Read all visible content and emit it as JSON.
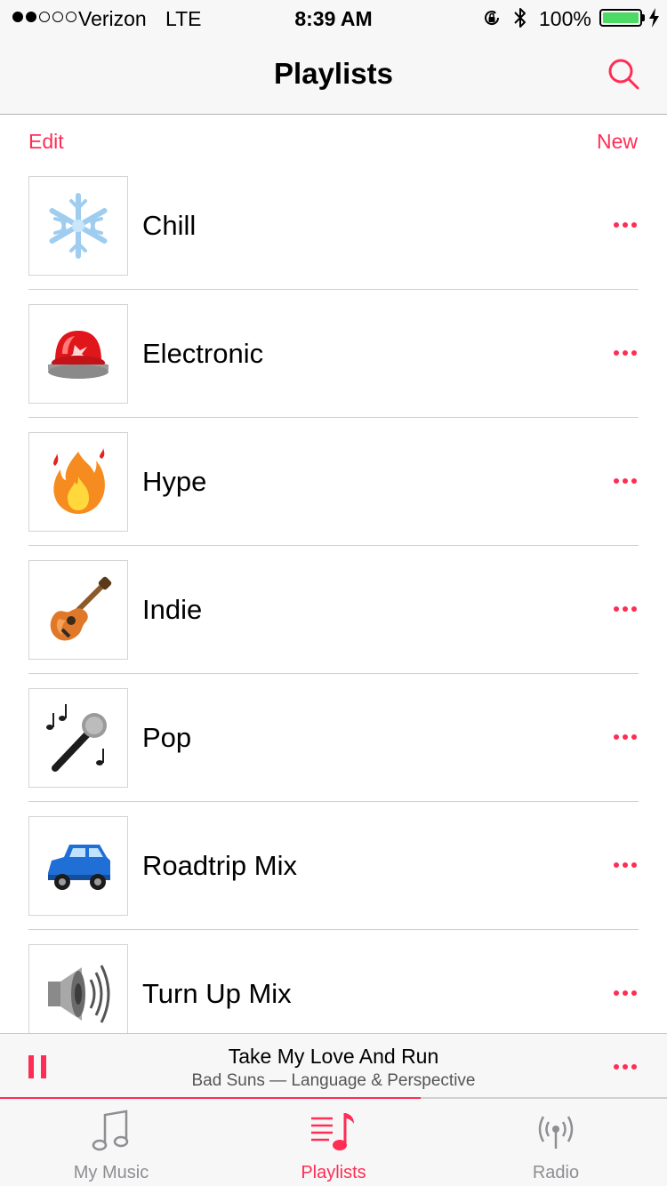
{
  "status_bar": {
    "signal_filled": 2,
    "signal_total": 5,
    "carrier": "Verizon",
    "network": "LTE",
    "time": "8:39 AM",
    "battery_percent": "100%",
    "battery_level": 1.0
  },
  "nav": {
    "title": "Playlists",
    "search_icon": "search-icon"
  },
  "actions": {
    "edit_label": "Edit",
    "new_label": "New"
  },
  "playlists": [
    {
      "title": "Chill",
      "art_icon": "snowflake-icon"
    },
    {
      "title": "Electronic",
      "art_icon": "siren-light-icon"
    },
    {
      "title": "Hype",
      "art_icon": "fire-icon"
    },
    {
      "title": "Indie",
      "art_icon": "guitar-icon"
    },
    {
      "title": "Pop",
      "art_icon": "microphone-icon"
    },
    {
      "title": "Roadtrip Mix",
      "art_icon": "car-icon"
    },
    {
      "title": "Turn Up Mix",
      "art_icon": "speaker-icon"
    }
  ],
  "now_playing": {
    "song": "Take My Love And Run",
    "subtitle": "Bad Suns — Language & Perspective",
    "progress": 0.63
  },
  "tabs": [
    {
      "label": "My Music",
      "icon": "music-note-icon",
      "active": false
    },
    {
      "label": "Playlists",
      "icon": "playlist-icon",
      "active": true
    },
    {
      "label": "Radio",
      "icon": "radio-antenna-icon",
      "active": false
    }
  ],
  "colors": {
    "accent": "#ff2d55",
    "battery": "#4cd964",
    "inactive_tab": "#8e8e93"
  }
}
